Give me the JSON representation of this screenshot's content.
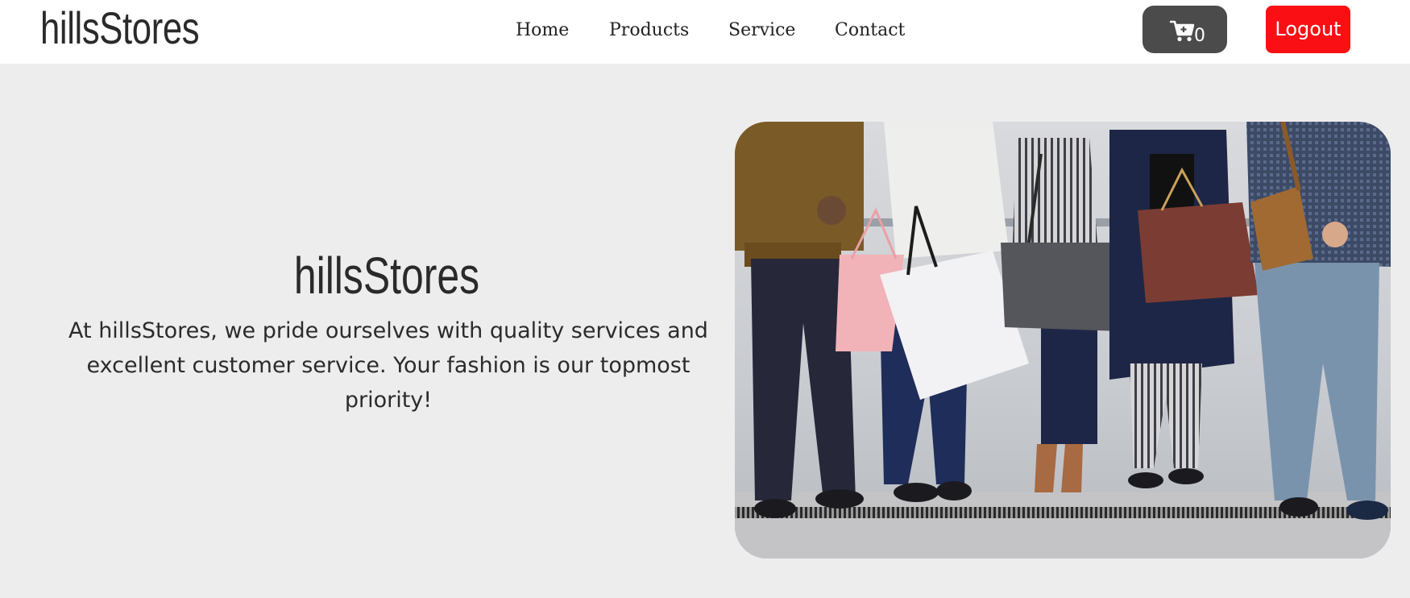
{
  "brand": {
    "name": "hillsStores"
  },
  "nav": {
    "items": [
      {
        "label": "Home"
      },
      {
        "label": "Products"
      },
      {
        "label": "Service"
      },
      {
        "label": "Contact"
      }
    ]
  },
  "cart": {
    "icon": "cart-plus-icon",
    "count": "0",
    "color": "#4b4b4b"
  },
  "logout": {
    "label": "Logout",
    "color": "#fa0f14"
  },
  "hero": {
    "title": "hillsStores",
    "text": "At hillsStores, we pride ourselves with quality services and excellent customer service. Your fashion is our topmost priority!",
    "image": "shopping-people-photo"
  },
  "colors": {
    "page_background": "#ededed",
    "header_background": "#ffffff",
    "text": "#2a2a2a"
  }
}
